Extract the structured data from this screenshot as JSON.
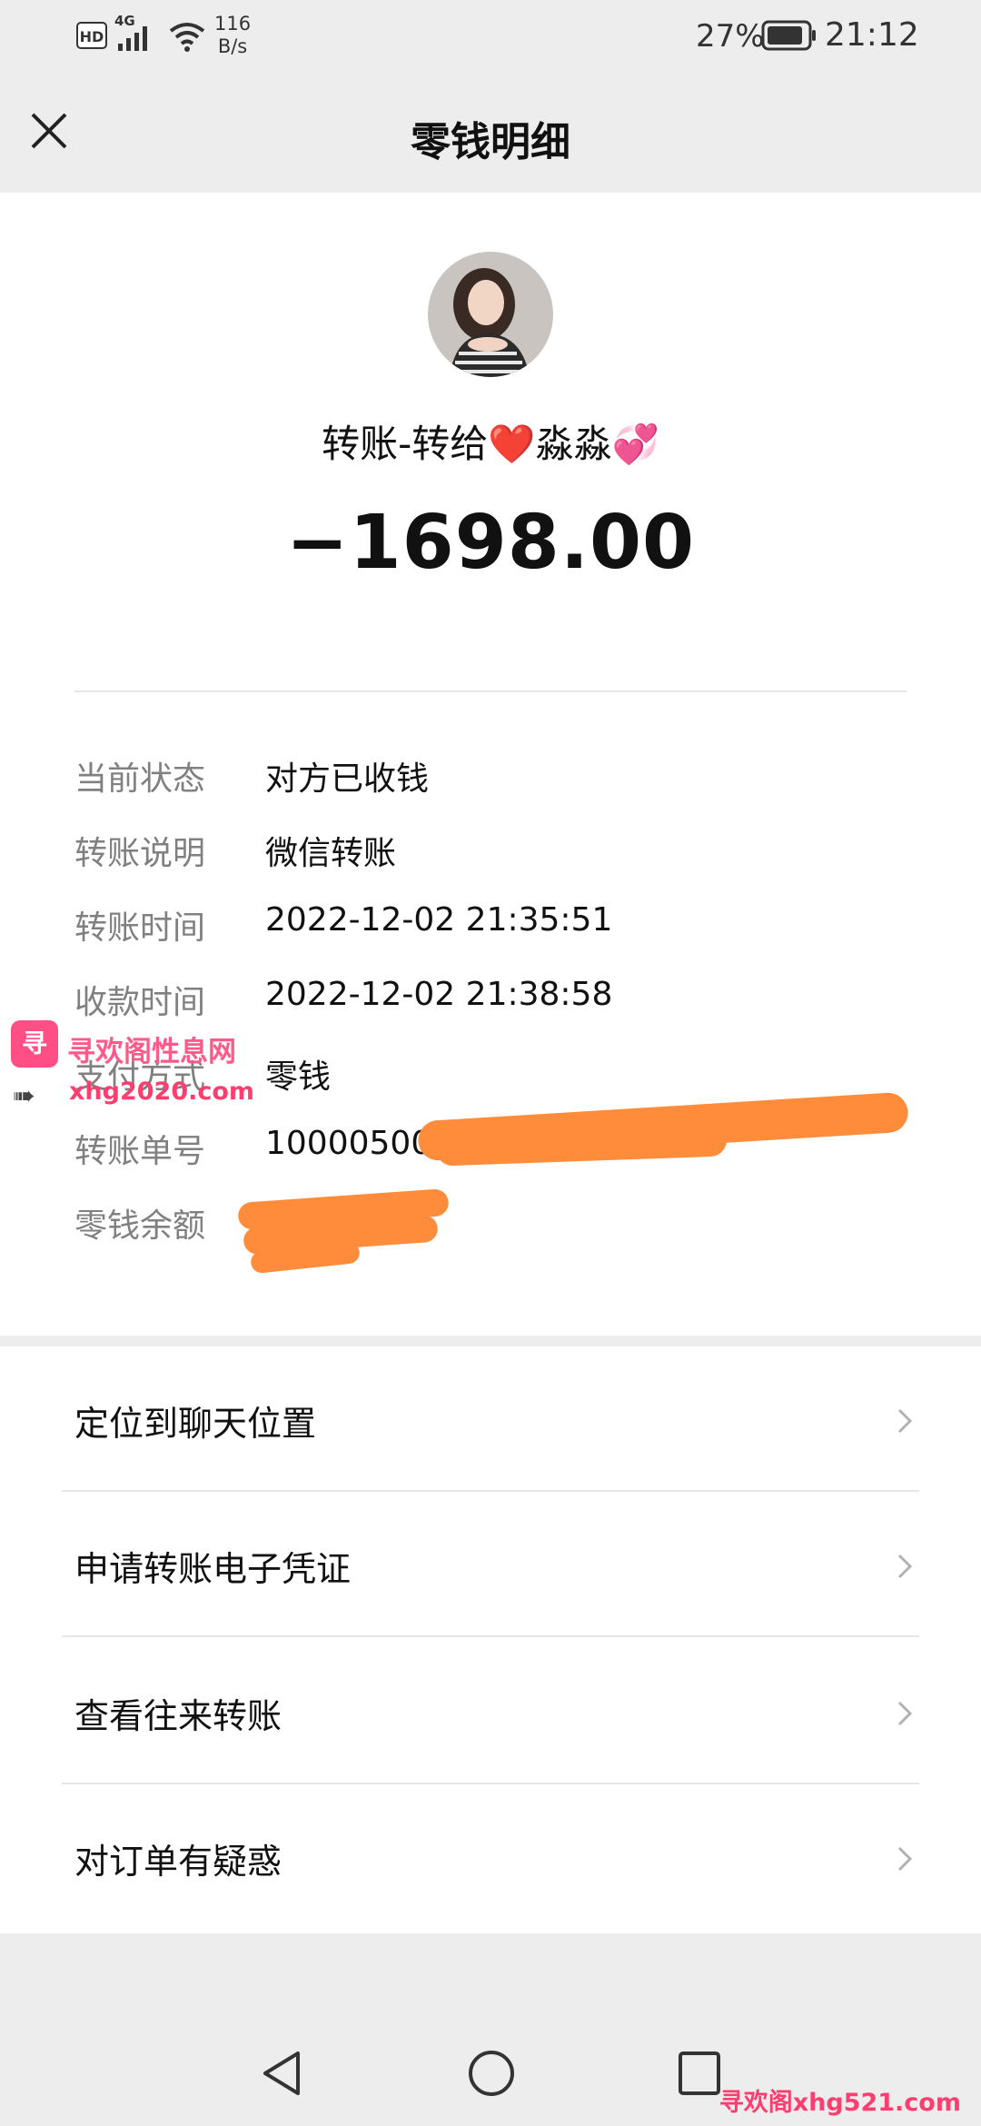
{
  "status_bar": {
    "hd": "HD",
    "network": "4G",
    "speed_value": "116",
    "speed_unit": "B/s",
    "battery_percent": "27%",
    "time": "21:12"
  },
  "header": {
    "title": "零钱明细"
  },
  "transfer": {
    "title": "转账-转给❤️淼淼💞",
    "amount": "−1698.00"
  },
  "details": [
    {
      "label": "当前状态",
      "value": "对方已收钱"
    },
    {
      "label": "转账说明",
      "value": "微信转账"
    },
    {
      "label": "转账时间",
      "value": "2022-12-02 21:35:51"
    },
    {
      "label": "收款时间",
      "value": "2022-12-02 21:38:58"
    },
    {
      "label": "支付方式",
      "value": "零钱"
    },
    {
      "label": "转账单号",
      "value": "10000500012"
    },
    {
      "label": "零钱余额",
      "value": ""
    }
  ],
  "actions": [
    {
      "label": "定位到聊天位置"
    },
    {
      "label": "申请转账电子凭证"
    },
    {
      "label": "查看往来转账"
    },
    {
      "label": "对订单有疑惑"
    }
  ],
  "watermark": {
    "logo_text": "寻欢",
    "site_name": "寻欢阁性息网",
    "url_1": "xhg2020.com",
    "url_2": "寻欢阁xhg521.com"
  },
  "colors": {
    "page_bg": "#ededed",
    "card_bg": "#ffffff",
    "label_gray": "#808080",
    "redaction_orange": "#ff8c3a",
    "watermark_pink": "#ff3e70"
  },
  "icons": {
    "close": "close-icon",
    "chevron": "chevron-right-icon",
    "nav_back": "triangle-back-icon",
    "nav_home": "circle-home-icon",
    "nav_recent": "square-recent-icon"
  }
}
